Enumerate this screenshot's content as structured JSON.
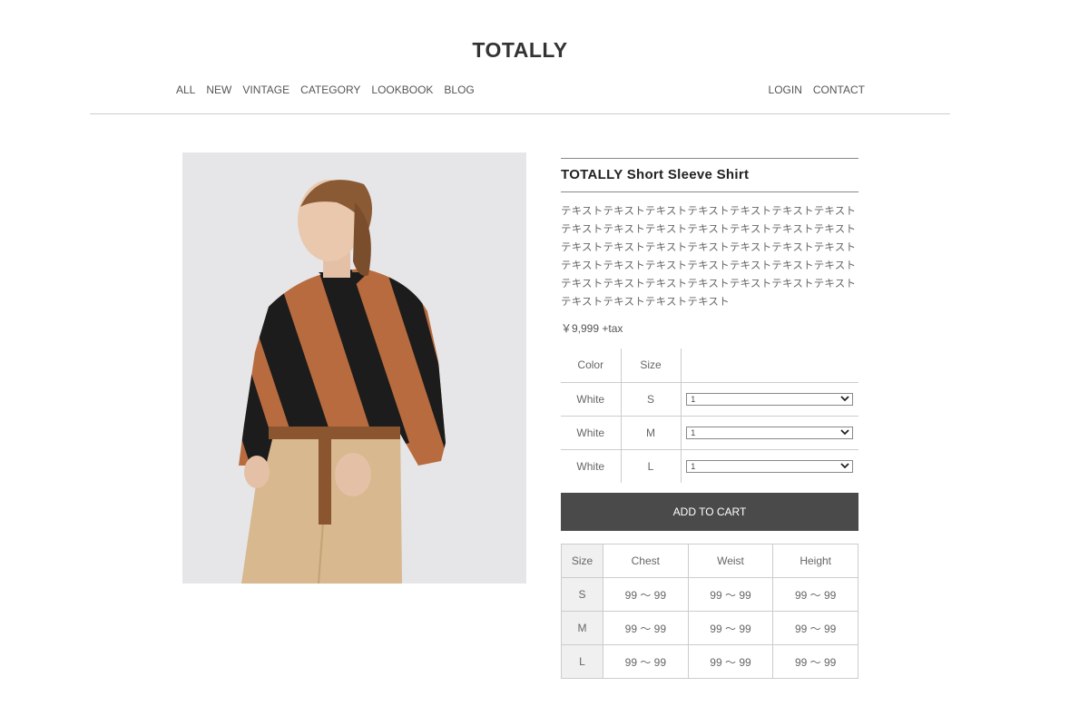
{
  "site": {
    "logo": "TOTALLY"
  },
  "nav": {
    "left": [
      "ALL",
      "NEW",
      "VINTAGE",
      "CATEGORY",
      "LOOKBOOK",
      "BLOG"
    ],
    "right": [
      "LOGIN",
      "CONTACT"
    ]
  },
  "product": {
    "title": "TOTALLY Short Sleeve Shirt",
    "description": "テキストテキストテキストテキストテキストテキストテキストテキストテキストテキストテキストテキストテキストテキストテキストテキストテキストテキストテキストテキストテキストテキストテキストテキストテキストテキストテキストテキストテキストテキストテキストテキストテキストテキストテキストテキストテキストテキストテキスト",
    "price": "￥9,999 +tax",
    "photo_alt": "model-wearing-striped-shirt"
  },
  "order": {
    "headers": [
      "Color",
      "Size",
      ""
    ],
    "rows": [
      {
        "color": "White",
        "size": "S",
        "qty": "1"
      },
      {
        "color": "White",
        "size": "M",
        "qty": "1"
      },
      {
        "color": "White",
        "size": "L",
        "qty": "1"
      }
    ]
  },
  "cart": {
    "label": "ADD TO CART"
  },
  "size_chart": {
    "headers": [
      "Size",
      "Chest",
      "Weist",
      "Height"
    ],
    "rows": [
      [
        "S",
        "99 ～ 99",
        "99 ～ 99",
        "99 ～ 99"
      ],
      [
        "M",
        "99 ～ 99",
        "99 ～ 99",
        "99 ～ 99"
      ],
      [
        "L",
        "99 ～ 99",
        "99 ～ 99",
        "99 ～ 99"
      ]
    ]
  },
  "colors": {
    "button_bg": "#4a4a4a",
    "stripe_orange": "#b86b3e",
    "stripe_black": "#1c1c1c"
  }
}
